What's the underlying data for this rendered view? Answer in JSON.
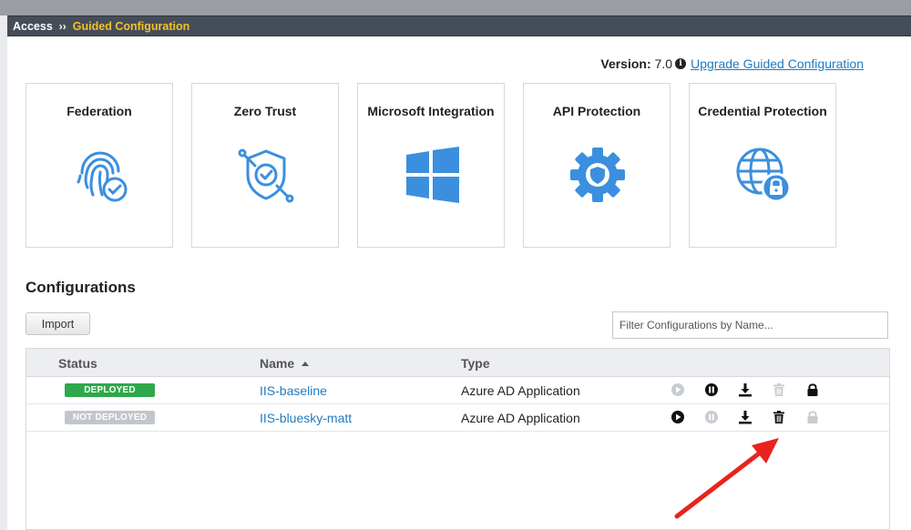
{
  "breadcrumb": {
    "root": "Access",
    "separator": "››",
    "current": "Guided Configuration"
  },
  "version": {
    "label": "Version:",
    "value": "7.0",
    "upgrade_link": "Upgrade Guided Configuration"
  },
  "cards": [
    {
      "title": "Federation",
      "icon": "fingerprint-check-icon"
    },
    {
      "title": "Zero Trust",
      "icon": "shield-check-icon"
    },
    {
      "title": "Microsoft Integration",
      "icon": "windows-logo-icon"
    },
    {
      "title": "API Protection",
      "icon": "gear-shield-icon"
    },
    {
      "title": "Credential Protection",
      "icon": "globe-lock-icon"
    }
  ],
  "configurations": {
    "title": "Configurations",
    "import_label": "Import",
    "filter_placeholder": "Filter Configurations by Name...",
    "columns": {
      "status": "Status",
      "name": "Name",
      "type": "Type"
    },
    "rows": [
      {
        "status": "DEPLOYED",
        "status_color": "#2ea84a",
        "name": "IIS-baseline",
        "type": "Azure AD Application",
        "actions": {
          "deploy": "disabled",
          "undeploy": "enabled",
          "download": "enabled",
          "delete": "disabled",
          "lock": "enabled"
        }
      },
      {
        "status": "NOT DEPLOYED",
        "status_color": "#c2c6cc",
        "name": "IIS-bluesky-matt",
        "type": "Azure AD Application",
        "actions": {
          "deploy": "enabled",
          "undeploy": "disabled",
          "download": "enabled",
          "delete": "enabled",
          "lock": "disabled"
        }
      }
    ]
  },
  "colors": {
    "accent": "#1f7bc1",
    "icon_blue": "#3b8fde",
    "breadcrumb_bg": "#454d58",
    "breadcrumb_current": "#f5c02a",
    "annotation_arrow": "#e8231d"
  }
}
